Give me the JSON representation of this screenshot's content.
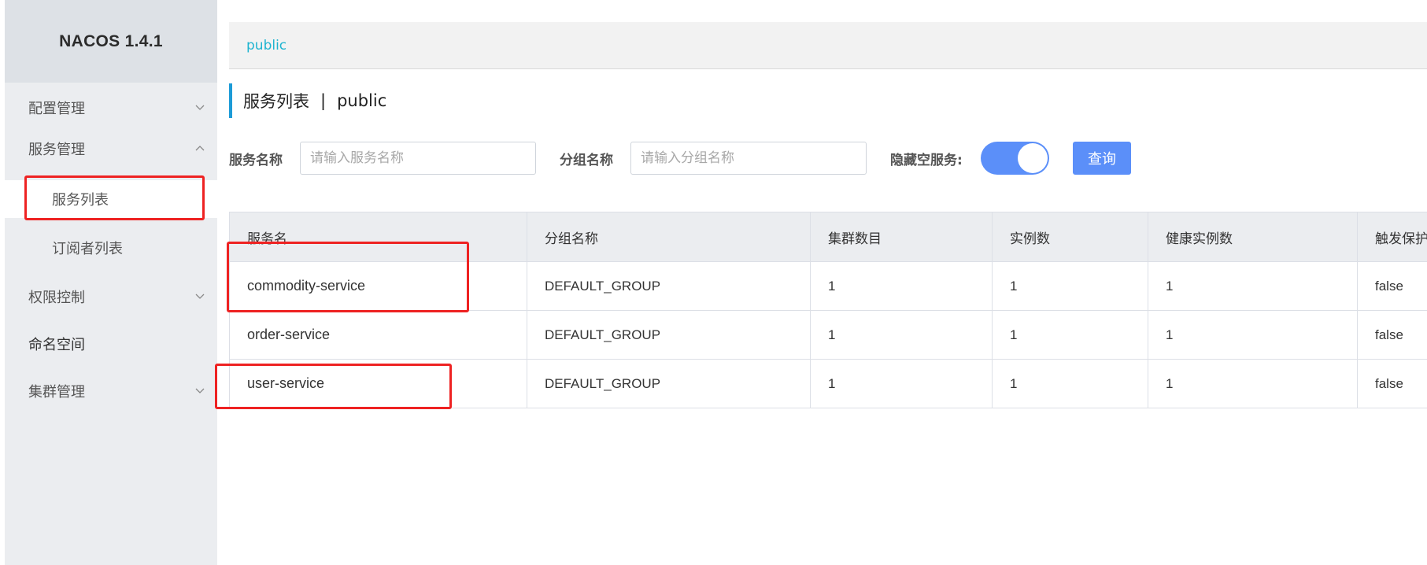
{
  "app": {
    "title": "NACOS 1.4.1"
  },
  "sidebar": {
    "items": [
      {
        "label": "配置管理",
        "expanded": false
      },
      {
        "label": "服务管理",
        "expanded": true
      },
      {
        "label": "服务列表",
        "sub": true,
        "active": true
      },
      {
        "label": "订阅者列表",
        "sub": true
      },
      {
        "label": "权限控制",
        "expanded": false
      },
      {
        "label": "命名空间"
      },
      {
        "label": "集群管理",
        "expanded": false
      }
    ]
  },
  "namespace_tabs": [
    {
      "label": "public",
      "active": true
    }
  ],
  "page": {
    "title": "服务列表",
    "separator": "|",
    "namespace": "public"
  },
  "filters": {
    "service_name_label": "服务名称",
    "service_name_placeholder": "请输入服务名称",
    "group_name_label": "分组名称",
    "group_name_placeholder": "请输入分组名称",
    "hide_empty_label": "隐藏空服务:",
    "hide_empty_on": true,
    "query_label": "查询"
  },
  "table": {
    "headers": [
      "服务名",
      "分组名称",
      "集群数目",
      "实例数",
      "健康实例数",
      "触发保护"
    ],
    "rows": [
      [
        "commodity-service",
        "DEFAULT_GROUP",
        "1",
        "1",
        "1",
        "false"
      ],
      [
        "order-service",
        "DEFAULT_GROUP",
        "1",
        "1",
        "1",
        "false"
      ],
      [
        "user-service",
        "DEFAULT_GROUP",
        "1",
        "1",
        "1",
        "false"
      ]
    ]
  },
  "colors": {
    "accent": "#5b8ff9",
    "tab_text": "#1fb4d0",
    "title_bar": "#1d9bd7",
    "highlight": "#ee2222",
    "sidebar_bg": "#ebedf0"
  }
}
